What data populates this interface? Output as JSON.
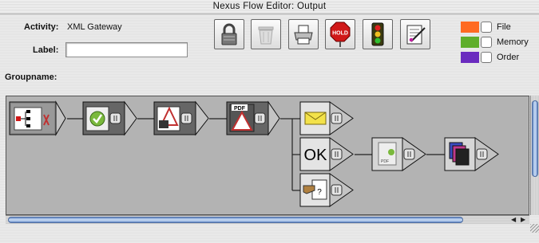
{
  "window": {
    "title": "Nexus Flow Editor: Output"
  },
  "form": {
    "activity_label": "Activity:",
    "activity_value": "XML Gateway",
    "label_label": "Label:",
    "label_value": "",
    "groupname_label": "Groupname:"
  },
  "toolbar": [
    {
      "name": "lock-button",
      "icon": "lock-icon"
    },
    {
      "name": "trash-button",
      "icon": "trash-icon"
    },
    {
      "name": "print-button",
      "icon": "printer-icon"
    },
    {
      "name": "hold-button",
      "icon": "stop-sign-icon",
      "text": "HOLD"
    },
    {
      "name": "traffic-light-button",
      "icon": "traffic-light-icon"
    },
    {
      "name": "edit-button",
      "icon": "edit-document-icon"
    }
  ],
  "legend": [
    {
      "label": "File",
      "color": "#ff6a22"
    },
    {
      "label": "Memory",
      "color": "#5fae2a"
    },
    {
      "label": "Order",
      "color": "#6a2bbf"
    }
  ],
  "flow": {
    "nodes": [
      {
        "name": "xml-gateway-node",
        "icon": "network-tree-icon"
      },
      {
        "name": "checkmark-node",
        "icon": "check-circle-icon"
      },
      {
        "name": "document-convert-node",
        "icon": "document-convert-icon"
      },
      {
        "name": "pdf-node",
        "icon": "pdf-document-icon",
        "text": "PDF"
      },
      {
        "name": "email-node",
        "icon": "envelope-icon"
      },
      {
        "name": "ok-node",
        "icon": "ok-icon",
        "text": "OK"
      },
      {
        "name": "pdf-check-node",
        "icon": "pdf-check-icon",
        "text": "PDF"
      },
      {
        "name": "stack-node",
        "icon": "document-stack-icon"
      },
      {
        "name": "help-node",
        "icon": "help-hand-icon",
        "text": "?"
      }
    ]
  }
}
